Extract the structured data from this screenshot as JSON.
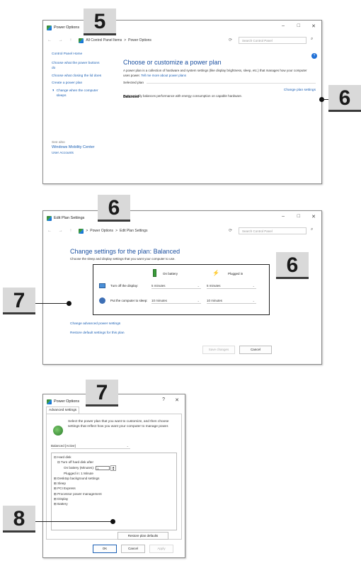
{
  "callouts": {
    "w1_top": "5",
    "w1_right": "6",
    "w2_top": "6",
    "w2_right": "6",
    "w2_left": "7",
    "w3_top": "7",
    "w3_left": "8"
  },
  "window1": {
    "title": "Power Options",
    "crumb_home": "All Control Panel Items",
    "crumb_sep": ">",
    "crumb_current": "Power Options",
    "search_placeholder": "Search Control Panel",
    "sidebar": {
      "items": [
        "Control Panel Home",
        "Choose what the power buttons do",
        "Choose what closing the lid does",
        "Create a power plan",
        "Change when the computer sleeps"
      ],
      "see_also": "See also",
      "mobility": "Windows Mobility Center",
      "accounts": "User Accounts"
    },
    "heading": "Choose or customize a power plan",
    "desc": "A power plan is a collection of hardware and system settings (like display brightness, sleep, etc.) that manages how your computer uses power.",
    "desc_link": "Tell me more about power plans",
    "selected_plan": "Selected plan",
    "plan_name": "Balanced",
    "plan_desc": "Automatically balances performance with energy consumption on capable hardware.",
    "change_link": "Change plan settings"
  },
  "window2": {
    "title": "Edit Plan Settings",
    "crumb_a": "Power Options",
    "crumb_sep": ">",
    "crumb_b": "Edit Plan Settings",
    "search_placeholder": "Search Control Panel",
    "heading": "Change settings for the plan: Balanced",
    "subheading": "Choose the sleep and display settings that you want your computer to use.",
    "col_battery": "On battery",
    "col_plugged": "Plugged in",
    "row1_label": "Turn off the display:",
    "row1_batt": "5 minutes",
    "row1_plug": "5 minutes",
    "row2_label": "Put the computer to sleep:",
    "row2_batt": "10 minutes",
    "row2_plug": "10 minutes",
    "adv_link": "Change advanced power settings",
    "restore_link": "Restore default settings for this plan",
    "save_btn": "Save changes",
    "cancel_btn": "Cancel"
  },
  "window3": {
    "title": "Power Options",
    "help": "?",
    "tab": "Advanced settings",
    "intro": "Select the power plan that you want to customize, and then choose settings that reflect how you want your computer to manage power.",
    "plan_select": "Balanced [Active]",
    "tree": [
      "⊟ Hard disk",
      "⊟ Turn off hard disk after",
      "On battery (Minutes):",
      "Plugged in: 1 Minute",
      "⊞ Desktop background settings",
      "⊞ Sleep",
      "⊞ PCI Express",
      "⊞ Processor power management",
      "⊞ Display",
      "⊞ Battery"
    ],
    "spin_value": "1",
    "restore_btn": "Restore plan defaults",
    "ok_btn": "OK",
    "cancel_btn": "Cancel",
    "apply_btn": "Apply"
  }
}
